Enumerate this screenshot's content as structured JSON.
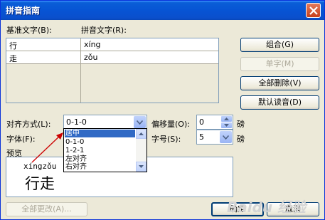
{
  "window": {
    "title": "拼音指南"
  },
  "labels": {
    "base_text": "基准文字(B):",
    "pinyin_text": "拼音文字(R):",
    "alignment": "对齐方式(L):",
    "offset": "偏移量(O):",
    "offset_unit": "磅",
    "font": "字体(F):",
    "size": "字号(S):",
    "size_unit": "磅",
    "preview": "预览"
  },
  "grid_rows": [
    {
      "base": "行",
      "pinyin": "xíng"
    },
    {
      "base": "走",
      "pinyin": "zǒu"
    },
    {
      "base": "",
      "pinyin": ""
    },
    {
      "base": "",
      "pinyin": ""
    },
    {
      "base": "",
      "pinyin": ""
    }
  ],
  "buttons": {
    "group": "组合(G)",
    "single": "单字(M)",
    "delete_all": "全部删除(V)",
    "default_reading": "默认读音(D)",
    "change_all": "全部更改(A)...",
    "ok": "确定",
    "cancel": "取消"
  },
  "alignment": {
    "value": "0-1-0",
    "options": [
      "居中",
      "0-1-0",
      "1-2-1",
      "左对齐",
      "右对齐"
    ],
    "selected_index": 0
  },
  "offset": {
    "value": "0"
  },
  "size": {
    "value": "5"
  },
  "preview": {
    "ruby": "xíngzǒu",
    "base": "行走"
  },
  "watermark": "Baidu 经验",
  "colors": {
    "title_bar": "#0a5ed7",
    "selection": "#316ac5",
    "annotation_arrow": "#cc0000"
  }
}
